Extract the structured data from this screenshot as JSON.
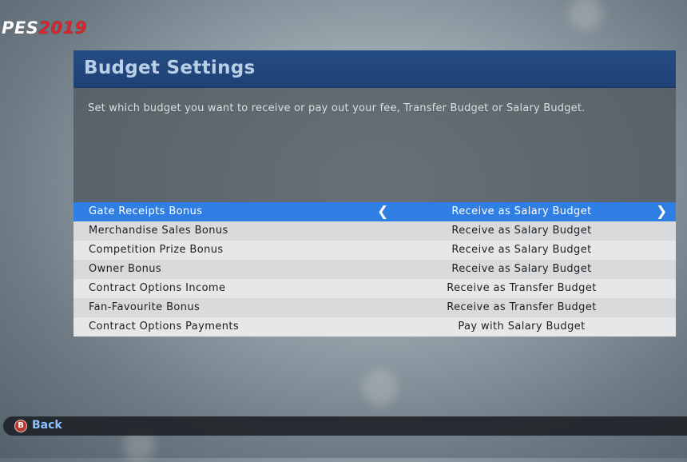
{
  "logo": {
    "pes": "PES",
    "year": "2019"
  },
  "panel": {
    "title": "Budget Settings",
    "description": "Set which budget you want to receive or pay out your fee, Transfer Budget or Salary Budget."
  },
  "settings": [
    {
      "label": "Gate Receipts Bonus",
      "value": "Receive as Salary Budget"
    },
    {
      "label": "Merchandise Sales Bonus",
      "value": "Receive as Salary Budget"
    },
    {
      "label": "Competition Prize Bonus",
      "value": "Receive as Salary Budget"
    },
    {
      "label": "Owner Bonus",
      "value": "Receive as Salary Budget"
    },
    {
      "label": "Contract Options Income",
      "value": "Receive as Transfer Budget"
    },
    {
      "label": "Fan-Favourite Bonus",
      "value": "Receive as Transfer Budget"
    },
    {
      "label": "Contract Options Payments",
      "value": "Pay with Salary Budget"
    }
  ],
  "selector": {
    "prev": "❮",
    "next": "❯"
  },
  "footer": {
    "button_glyph": "B",
    "back_label": "Back"
  },
  "colors": {
    "selected_row": "#2f7ee3",
    "header": "#254c84",
    "logo_year": "#d7262f"
  }
}
